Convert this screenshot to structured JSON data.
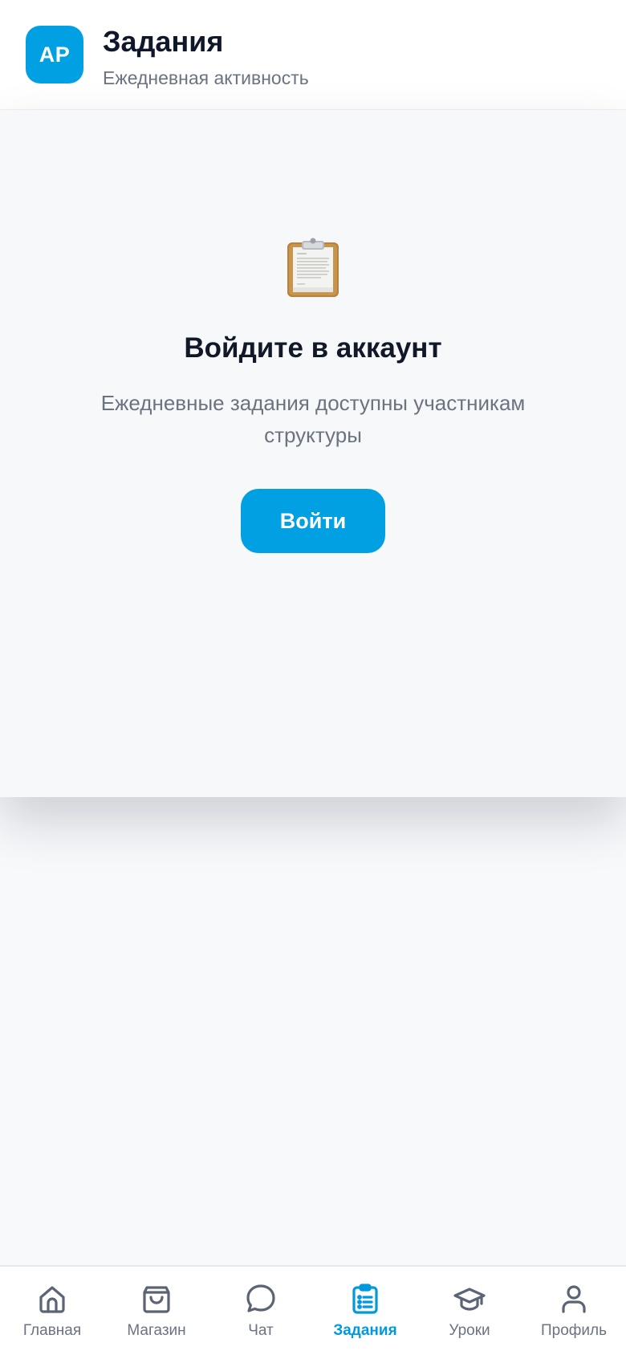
{
  "header": {
    "avatar_initials": "AP",
    "title": "Задания",
    "subtitle": "Ежедневная активность"
  },
  "empty_state": {
    "icon": "clipboard-icon",
    "title": "Войдите в аккаунт",
    "description": "Ежедневные задания доступны участникам структуры",
    "button_label": "Войти"
  },
  "tabbar": {
    "items": [
      {
        "label": "Главная",
        "icon": "home-icon"
      },
      {
        "label": "Магазин",
        "icon": "shopping-bag-icon"
      },
      {
        "label": "Чат",
        "icon": "chat-bubble-icon"
      },
      {
        "label": "Задания",
        "icon": "clipboard-list-icon",
        "active": true
      },
      {
        "label": "Уроки",
        "icon": "graduation-cap-icon"
      },
      {
        "label": "Профиль",
        "icon": "user-icon"
      }
    ]
  },
  "colors": {
    "accent": "#00a0e3",
    "text_primary": "#0f172a",
    "text_secondary": "#6b7280",
    "inactive_icon": "#5b6475"
  }
}
